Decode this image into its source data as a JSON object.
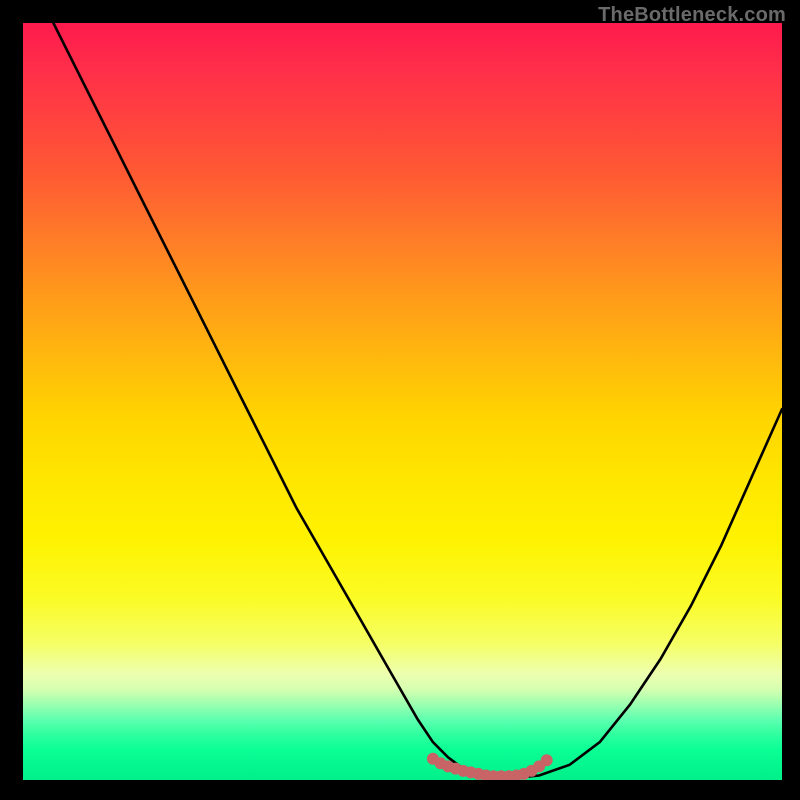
{
  "watermark": "TheBottleneck.com",
  "colors": {
    "background": "#000000",
    "gradient_top": "#ff1a4d",
    "gradient_bottom": "#00ef8a",
    "curve": "#000000",
    "marker": "#c86465"
  },
  "chart_data": {
    "type": "line",
    "title": "",
    "xlabel": "",
    "ylabel": "",
    "xlim": [
      0,
      100
    ],
    "ylim": [
      0,
      100
    ],
    "axes_visible": false,
    "grid": false,
    "description": "V-shaped bottleneck curve with flat minimum; gradient background from red (top/high bottleneck) to green (bottom/no bottleneck).",
    "series": [
      {
        "name": "bottleneck_curve",
        "color": "#000000",
        "style": "line",
        "x": [
          4,
          8,
          12,
          16,
          20,
          24,
          28,
          32,
          36,
          40,
          44,
          48,
          52,
          54,
          56,
          58,
          60,
          62,
          64,
          68,
          72,
          76,
          80,
          84,
          88,
          92,
          96,
          100
        ],
        "y": [
          100,
          92,
          84,
          76,
          68,
          60,
          52,
          44,
          36,
          29,
          22,
          15,
          8,
          5,
          3,
          1.5,
          0.6,
          0.2,
          0.2,
          0.6,
          2,
          5,
          10,
          16,
          23,
          31,
          40,
          49
        ]
      },
      {
        "name": "flat_zone",
        "color": "#c86465",
        "style": "markers",
        "x": [
          54,
          55,
          56,
          57,
          58,
          59,
          60,
          61,
          62,
          63,
          64,
          65,
          66,
          67,
          68,
          69
        ],
        "y": [
          2.8,
          2.2,
          1.8,
          1.5,
          1.2,
          1.0,
          0.8,
          0.6,
          0.5,
          0.5,
          0.5,
          0.6,
          0.8,
          1.2,
          1.8,
          2.6
        ]
      }
    ]
  }
}
